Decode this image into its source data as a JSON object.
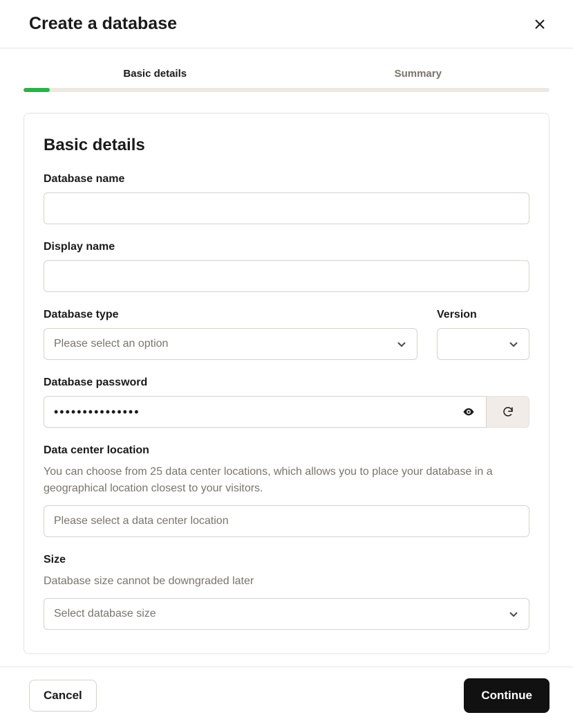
{
  "header": {
    "title": "Create a database"
  },
  "tabs": {
    "items": [
      {
        "label": "Basic details",
        "active": true
      },
      {
        "label": "Summary",
        "active": false
      }
    ],
    "progress_percent": 5
  },
  "section": {
    "title": "Basic details"
  },
  "fields": {
    "database_name": {
      "label": "Database name",
      "value": ""
    },
    "display_name": {
      "label": "Display name",
      "value": ""
    },
    "database_type": {
      "label": "Database type",
      "placeholder": "Please select an option",
      "value": ""
    },
    "version": {
      "label": "Version",
      "value": ""
    },
    "password": {
      "label": "Database password",
      "masked_value": "•••••••••••••••"
    },
    "location": {
      "label": "Data center location",
      "help": "You can choose from 25 data center locations, which allows you to place your database in a geographical location closest to your visitors.",
      "placeholder": "Please select a data center location",
      "value": ""
    },
    "size": {
      "label": "Size",
      "help": "Database size cannot be downgraded later",
      "placeholder": "Select database size",
      "value": ""
    }
  },
  "footer": {
    "cancel_label": "Cancel",
    "continue_label": "Continue"
  }
}
